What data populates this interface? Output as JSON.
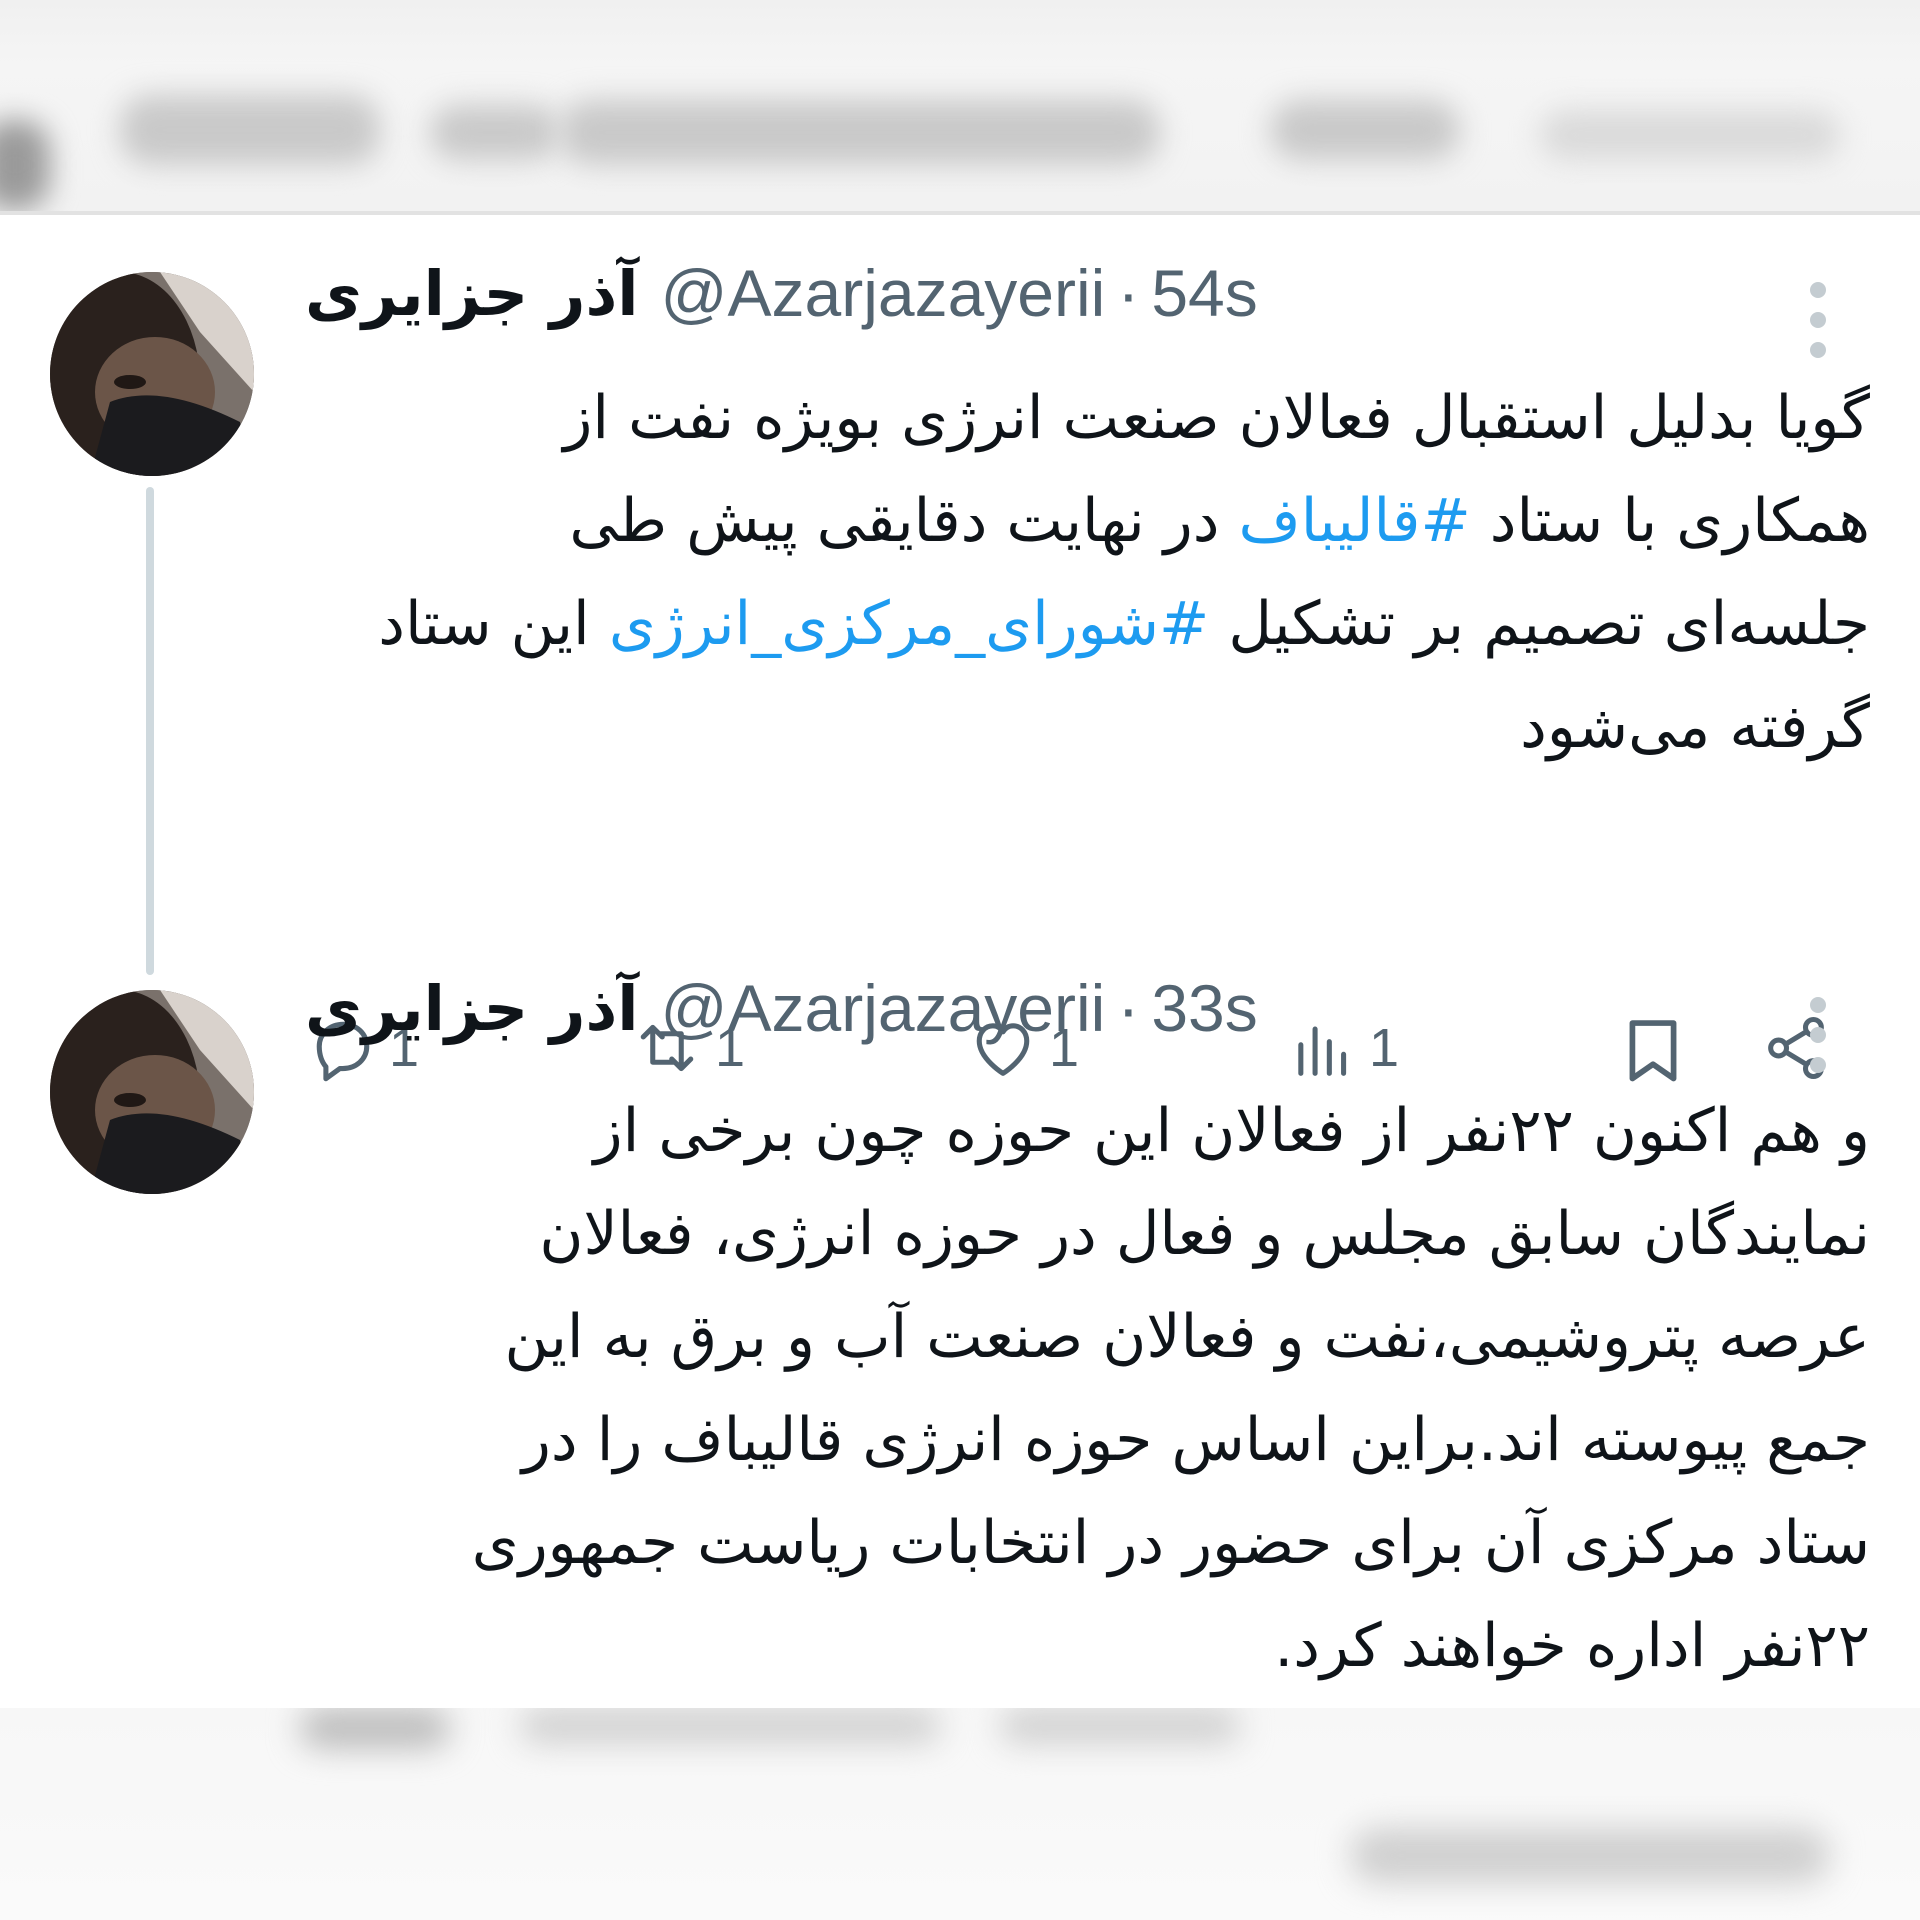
{
  "colors": {
    "hashtag": "#1d9bf0",
    "muted": "#536471",
    "text": "#0f1419",
    "thread_line": "#cfd9de"
  },
  "tweets": [
    {
      "display_name": "آذر جزایری",
      "handle": "@Azarjazayerii",
      "separator": "·",
      "time": "54s",
      "lines": [
        {
          "parts": [
            {
              "text": "گویا بدلیل استقبال فعالان صنعت انرژی بویژه نفت از"
            }
          ]
        },
        {
          "parts": [
            {
              "text": "همکاری با ستاد "
            },
            {
              "text": "#قالیباف",
              "hashtag": true
            },
            {
              "text": " در نهایت دقایقی پیش طی"
            }
          ]
        },
        {
          "parts": [
            {
              "text": "جلسه‌ای تصمیم بر تشکیل "
            },
            {
              "text": "#شورای_مرکزی_انرژی",
              "hashtag": true
            },
            {
              "text": " این ستاد"
            }
          ]
        },
        {
          "parts": [
            {
              "text": "گرفته می‌شود"
            }
          ]
        }
      ],
      "actions": {
        "reply_icon": "reply-icon",
        "reply_count": "1",
        "retweet_icon": "retweet-icon",
        "retweet_count": "1",
        "like_icon": "heart-icon",
        "like_count": "1",
        "views_icon": "views-chart-icon",
        "views_count": "1",
        "bookmark_icon": "bookmark-icon",
        "share_icon": "share-icon"
      }
    },
    {
      "display_name": "آذر جزایری",
      "handle": "@Azarjazayerii",
      "separator": "·",
      "time": "33s",
      "lines": [
        {
          "parts": [
            {
              "text": "و هم اکنون ۲۲نفر از فعالان این حوزه چون برخی از"
            }
          ]
        },
        {
          "parts": [
            {
              "text": "نمایندگان سابق مجلس و فعال در حوزه انرژی، فعالان"
            }
          ]
        },
        {
          "parts": [
            {
              "text": "عرصه پتروشیمی،نفت و فعالان صنعت آب و برق به این"
            }
          ]
        },
        {
          "parts": [
            {
              "text": "جمع پیوسته اند.براین اساس حوزه انرژی قالیباف را در"
            }
          ]
        },
        {
          "parts": [
            {
              "text": "ستاد مرکزی آن برای حضور در انتخابات ریاست جمهوری"
            }
          ]
        },
        {
          "parts": [
            {
              "text": "۲۲نفر اداره خواهند کرد."
            }
          ]
        }
      ]
    }
  ]
}
